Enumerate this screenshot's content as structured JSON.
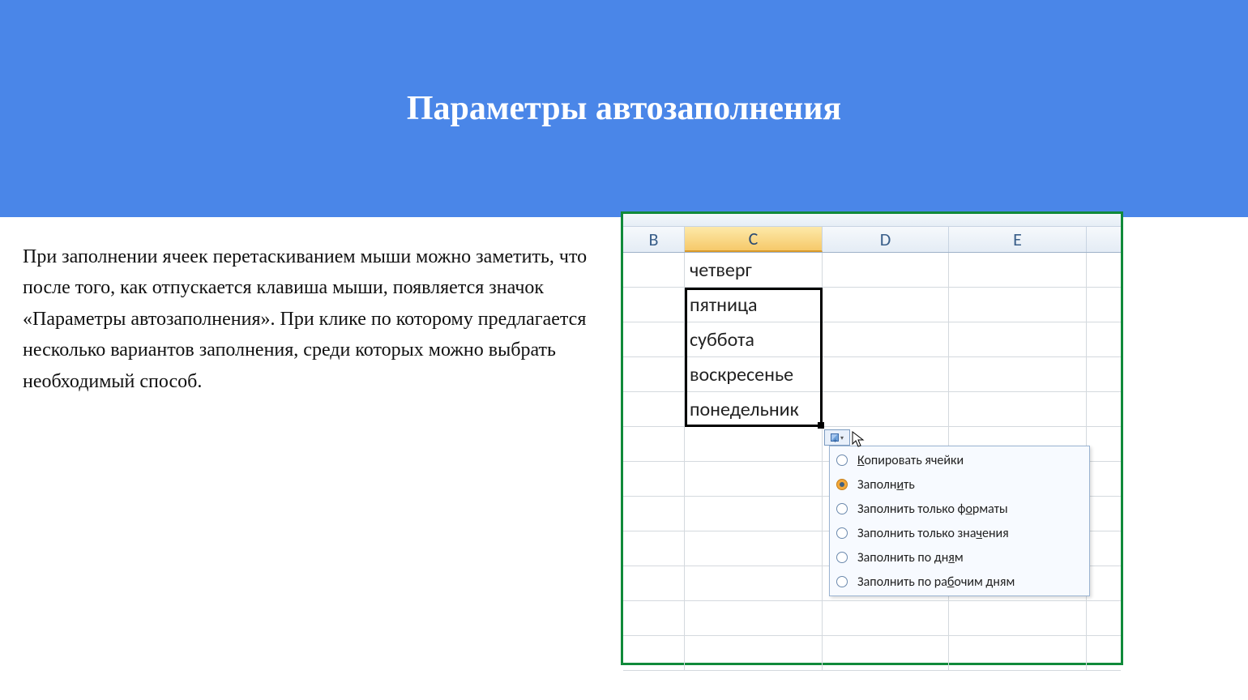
{
  "header": {
    "title": "Параметры автозаполнения"
  },
  "body": {
    "paragraph": "При заполнении ячеек перетаскиванием мыши можно заметить, что после того, как отпускается клавиша мыши, появляется значок «Параметры автозаполнения». При клике по которому предлагается несколько вариантов заполнения, среди которых можно выбрать необходимый способ."
  },
  "excel": {
    "columns": [
      "B",
      "C",
      "D",
      "E",
      ""
    ],
    "selected_column": "C",
    "days": [
      "четверг",
      "пятница",
      "суббота",
      "воскресенье",
      "понедельник"
    ],
    "blank_rows_after": 7,
    "autofill_menu": {
      "items": [
        {
          "label_pre": "",
          "underline": "К",
          "label_post": "опировать ячейки",
          "selected": false
        },
        {
          "label_pre": "Заполн",
          "underline": "и",
          "label_post": "ть",
          "selected": true
        },
        {
          "label_pre": "Заполнить только ф",
          "underline": "о",
          "label_post": "рматы",
          "selected": false
        },
        {
          "label_pre": "Заполнить только зна",
          "underline": "ч",
          "label_post": "ения",
          "selected": false
        },
        {
          "label_pre": "Заполнить по дн",
          "underline": "я",
          "label_post": "м",
          "selected": false
        },
        {
          "label_pre": "Заполнить по ра",
          "underline": "б",
          "label_post": "очим дням",
          "selected": false
        }
      ]
    }
  }
}
